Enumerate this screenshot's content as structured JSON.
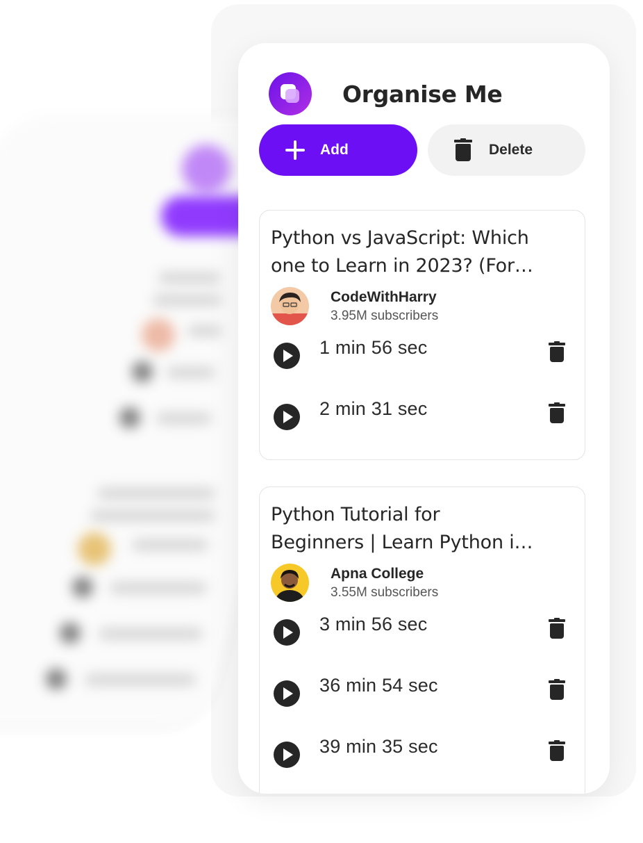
{
  "app": {
    "title": "Organise Me"
  },
  "toolbar": {
    "add_label": "Add",
    "delete_label": "Delete"
  },
  "colors": {
    "accent": "#6d0ff5",
    "logo_gradient_start": "#6b12e8",
    "logo_gradient_end": "#b02fe6",
    "text": "#262626",
    "secondary_button": "#f2f2f2"
  },
  "icons": {
    "logo": "app-logo-icon",
    "add": "plus-icon",
    "delete": "trash-icon",
    "play": "play-icon"
  },
  "videos": [
    {
      "title_line1": "Python vs JavaScript: Which",
      "title_line2": "one to Learn in 2023? (For…",
      "channel": "CodeWithHarry",
      "subscribers": "3.95M subscribers",
      "clips": [
        "1 min 56 sec",
        "2 min 31 sec"
      ]
    },
    {
      "title_line1": "Python Tutorial for",
      "title_line2": "Beginners | Learn Python i…",
      "channel": "Apna College",
      "subscribers": "3.55M subscribers",
      "clips": [
        "3 min 56 sec",
        "36 min 54 sec",
        "39 min 35 sec"
      ]
    }
  ]
}
